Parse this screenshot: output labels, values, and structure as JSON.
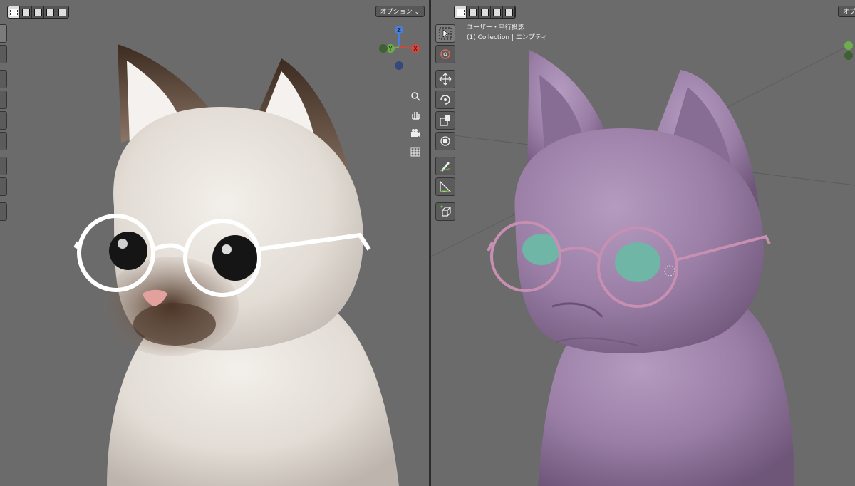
{
  "left_viewport": {
    "options_label": "オプション ⌄",
    "selection_modes": [
      "set",
      "extend",
      "subtract",
      "invert",
      "intersect"
    ],
    "navigation_icons": [
      "zoom-icon",
      "hand-pan-icon",
      "camera-icon",
      "grid-icon"
    ],
    "gizmo": {
      "z_label": "Z",
      "y_label": "Y",
      "x_label": "X"
    }
  },
  "right_viewport": {
    "options_label": "オプ",
    "view_title": "ユーザー・平行投影",
    "view_subtitle": "(1) Collection | エンプティ",
    "selection_modes": [
      "set",
      "extend",
      "subtract",
      "invert",
      "intersect"
    ],
    "tools": [
      "select-box",
      "cursor",
      "move",
      "rotate",
      "scale",
      "transform",
      "annotate",
      "measure",
      "add-cube"
    ]
  },
  "colors": {
    "viewport_bg": "#6b6b6b",
    "left_cat_fur": "#e6e1dc",
    "left_cat_points": "#5a4030",
    "right_cat_clay": "#9a7ea6",
    "glasses_left": "#ffffff",
    "glasses_right": "#c78fb2",
    "eyes_right": "#6fb6a6",
    "axis_x": "#d9453a",
    "axis_y": "#6cae4b",
    "axis_z": "#4a7ed8"
  }
}
